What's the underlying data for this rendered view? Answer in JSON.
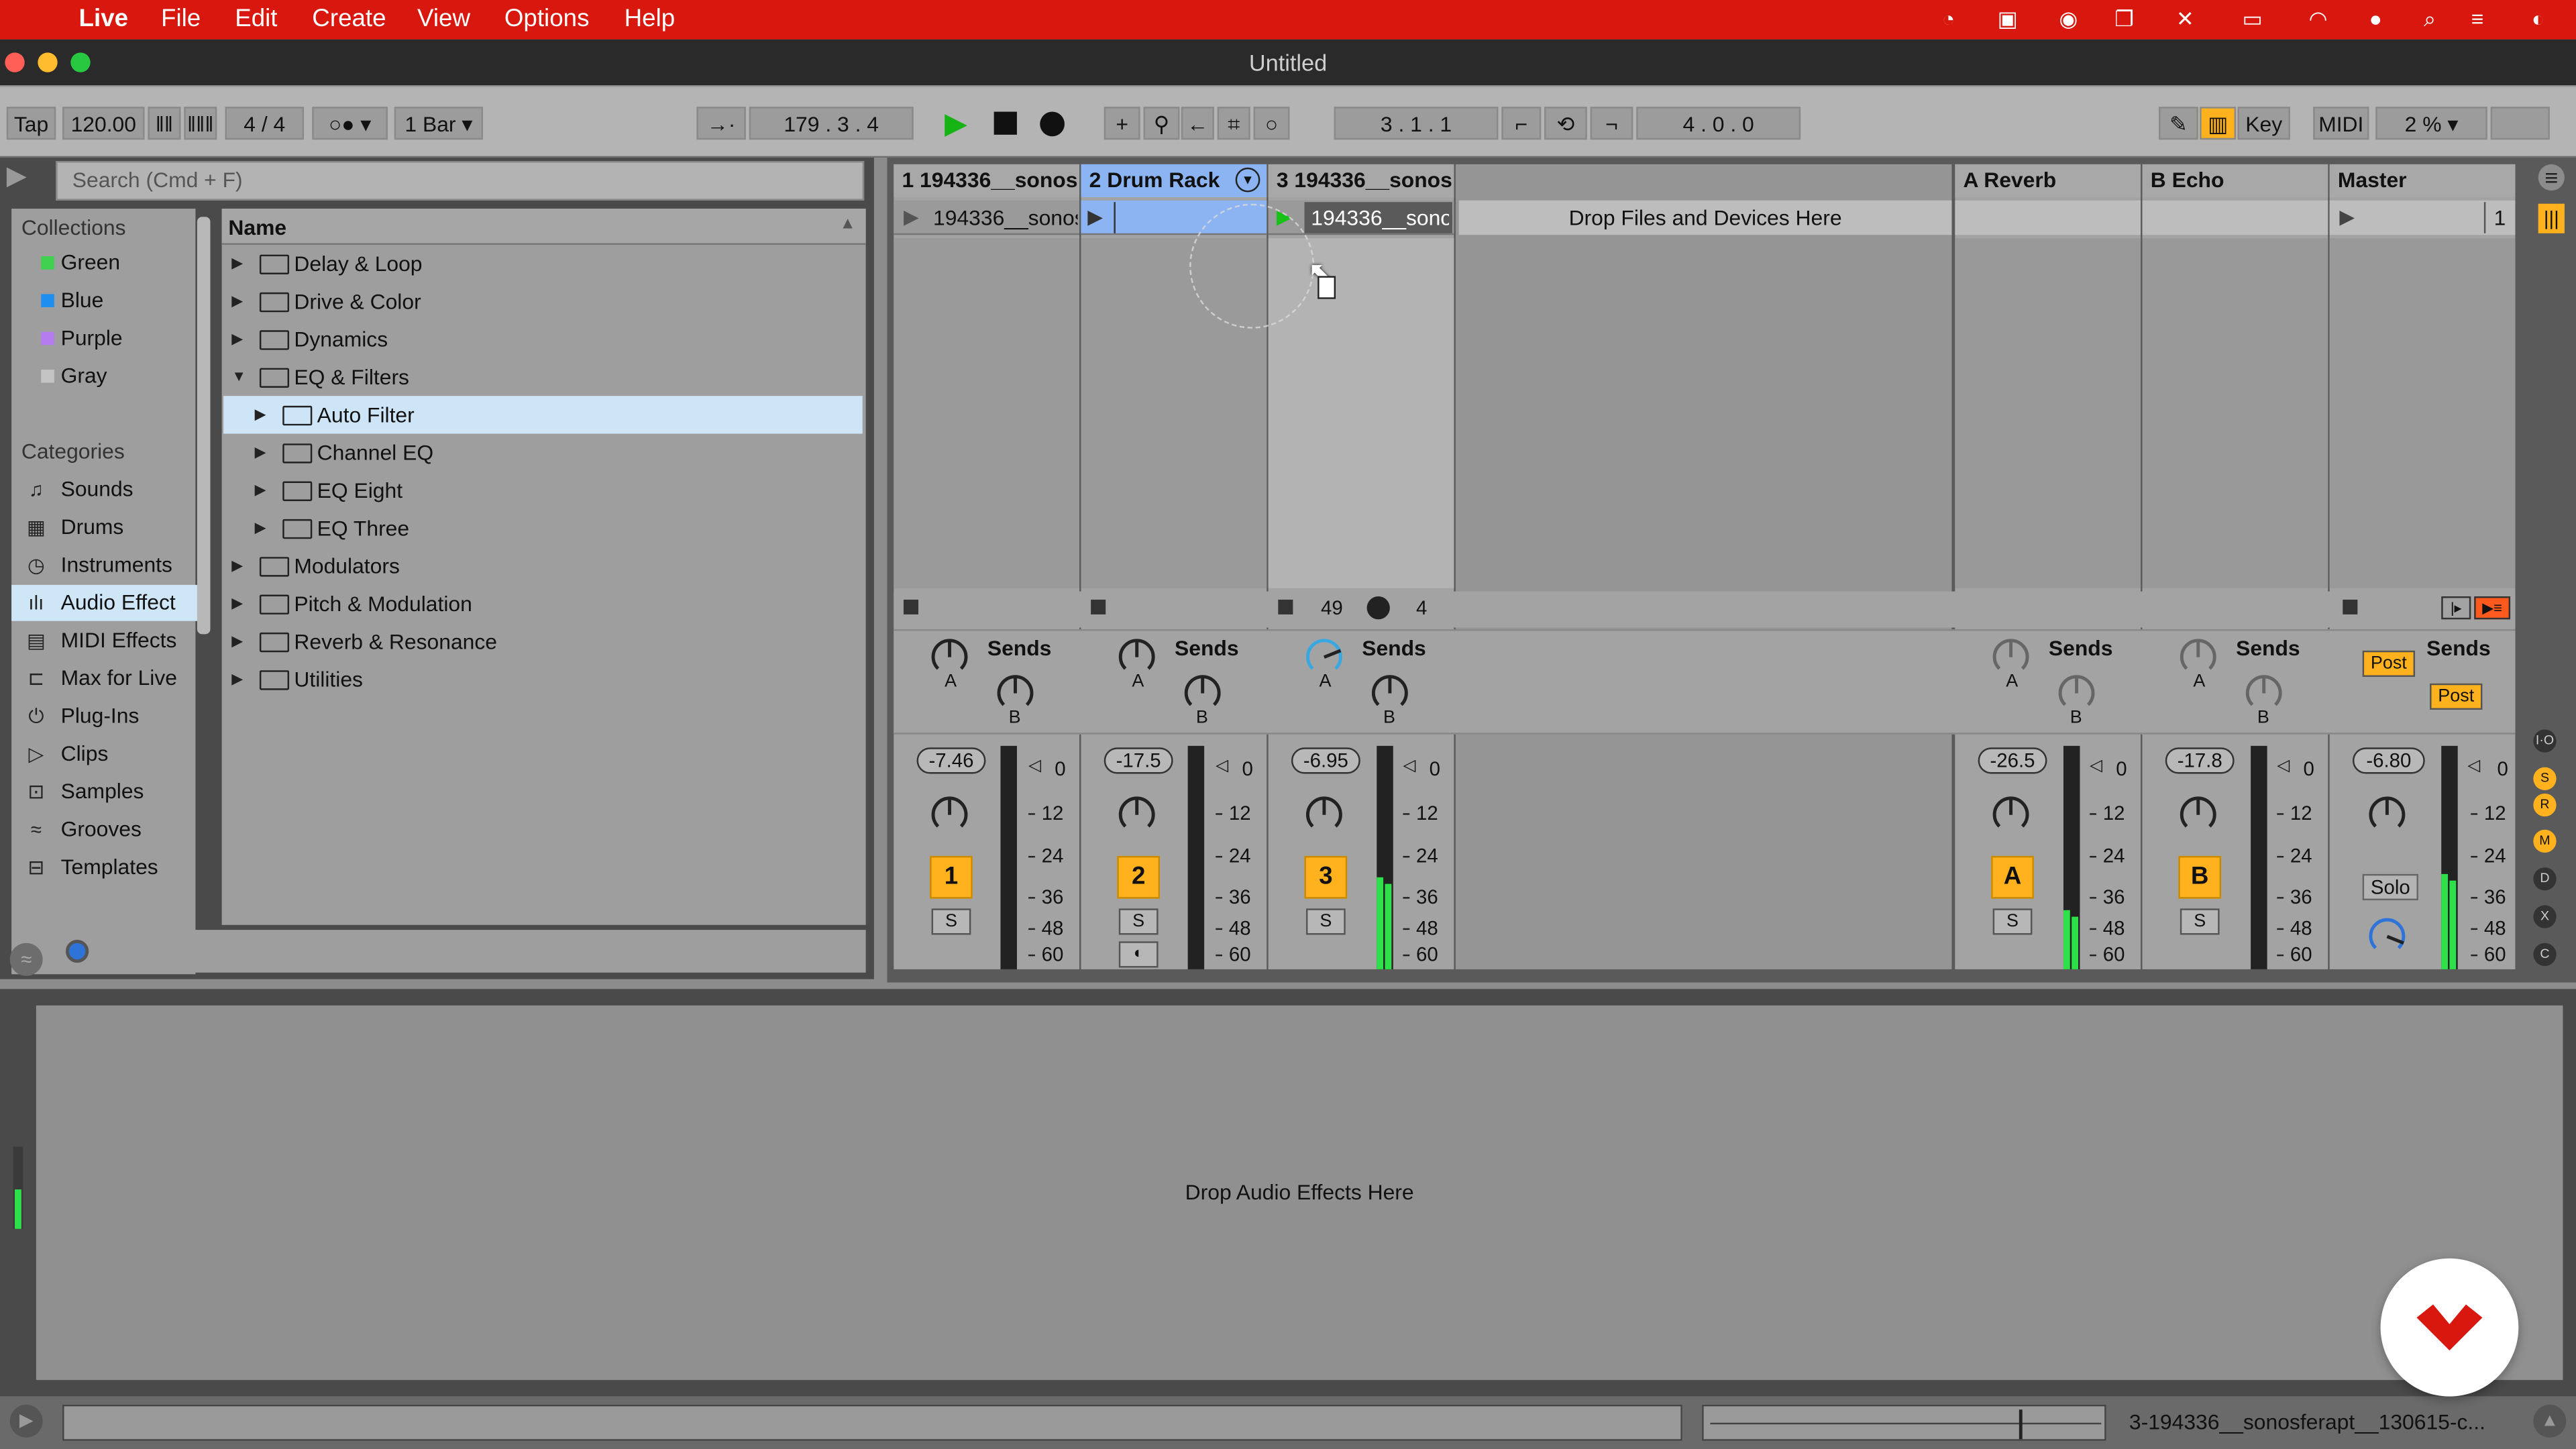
{
  "menubar": {
    "apple": "",
    "items": [
      "Live",
      "File",
      "Edit",
      "Create",
      "View",
      "Options",
      "Help"
    ]
  },
  "window": {
    "title": "Untitled"
  },
  "control": {
    "tap": "Tap",
    "tempo": "120.00",
    "signature": "4 / 4",
    "quantize": "1 Bar",
    "song_position": [
      "179",
      "3",
      "4"
    ],
    "loop_start": [
      "3",
      "1",
      "1"
    ],
    "loop_length": [
      "4",
      "0",
      "0"
    ],
    "key": "Key",
    "midi": "MIDI",
    "cpu": "2 %"
  },
  "browser": {
    "search_placeholder": "Search (Cmd + F)",
    "collections_title": "Collections",
    "collections": [
      {
        "label": "Green",
        "color": "#3ed04e"
      },
      {
        "label": "Blue",
        "color": "#1e8ff0"
      },
      {
        "label": "Purple",
        "color": "#b57cf0"
      },
      {
        "label": "Gray",
        "color": "#c4c4c4"
      }
    ],
    "categories_title": "Categories",
    "categories": [
      "Sounds",
      "Drums",
      "Instruments",
      "Audio Effect",
      "MIDI Effects",
      "Max for Live",
      "Plug-Ins",
      "Clips",
      "Samples",
      "Grooves",
      "Templates"
    ],
    "name_header": "Name",
    "tree": [
      {
        "label": "Delay & Loop",
        "indent": 0
      },
      {
        "label": "Drive & Color",
        "indent": 0
      },
      {
        "label": "Dynamics",
        "indent": 0
      },
      {
        "label": "EQ & Filters",
        "indent": 0,
        "open": true
      },
      {
        "label": "Auto Filter",
        "indent": 1,
        "selected": true
      },
      {
        "label": "Channel EQ",
        "indent": 1
      },
      {
        "label": "EQ Eight",
        "indent": 1
      },
      {
        "label": "EQ Three",
        "indent": 1
      },
      {
        "label": "Modulators",
        "indent": 0
      },
      {
        "label": "Pitch & Modulation",
        "indent": 0
      },
      {
        "label": "Reverb & Resonance",
        "indent": 0
      },
      {
        "label": "Utilities",
        "indent": 0
      }
    ]
  },
  "session": {
    "drop_files": "Drop Files and Devices Here",
    "tracks": [
      {
        "name": "1 194336__sonos",
        "clip": "194336__sonos",
        "volume": "-7.46",
        "number": "1",
        "solo": "S"
      },
      {
        "name": "2 Drum Rack",
        "clip": "",
        "volume": "-17.5",
        "number": "2",
        "solo": "S"
      },
      {
        "name": "3 194336__sonos",
        "clip": "194336__sonos",
        "volume": "-6.95",
        "number": "3",
        "solo": "S",
        "stat_left": "49",
        "stat_right": "4"
      }
    ],
    "returns": [
      {
        "name": "A Reverb",
        "volume": "-26.5",
        "letter": "A",
        "solo": "S"
      },
      {
        "name": "B Echo",
        "volume": "-17.8",
        "letter": "B",
        "solo": "S"
      }
    ],
    "master": {
      "name": "Master",
      "volume": "-6.80",
      "solo": "Solo",
      "scene": "1",
      "post1": "Post",
      "post2": "Post"
    },
    "sends_label": "Sends",
    "knob_a": "A",
    "knob_b": "B",
    "meter_scale": [
      "0",
      "12",
      "24",
      "36",
      "48",
      "60"
    ]
  },
  "detail": {
    "drop_effects": "Drop Audio Effects Here"
  },
  "status": {
    "text": "3-194336__sonosferapt__130615-c..."
  }
}
